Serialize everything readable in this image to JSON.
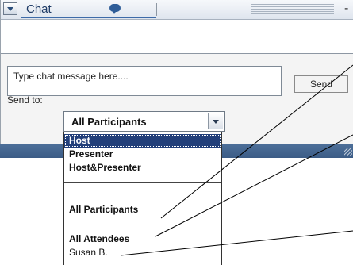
{
  "titlebar": {
    "title": "Chat",
    "collapse_icon": "triangle-down-icon",
    "chat_icon": "speech-bubble-icon",
    "close_label": "-"
  },
  "compose": {
    "placeholder": "Type chat message here....",
    "send_label": "Send"
  },
  "send_to": {
    "label": "Send to:",
    "selected": "All Participants"
  },
  "dropdown": {
    "options": [
      {
        "label": "Host",
        "selected": true
      },
      {
        "label": "Presenter",
        "selected": false
      },
      {
        "label": "Host&Presenter",
        "selected": false
      },
      {
        "label": "All Participants",
        "selected": false
      },
      {
        "label": "All Attendees",
        "selected": false
      },
      {
        "label": "Susan B.",
        "selected": false
      }
    ]
  },
  "colors": {
    "selection": "#223f7a",
    "footer": "#3c5c86",
    "title_text": "#1e3b66"
  }
}
